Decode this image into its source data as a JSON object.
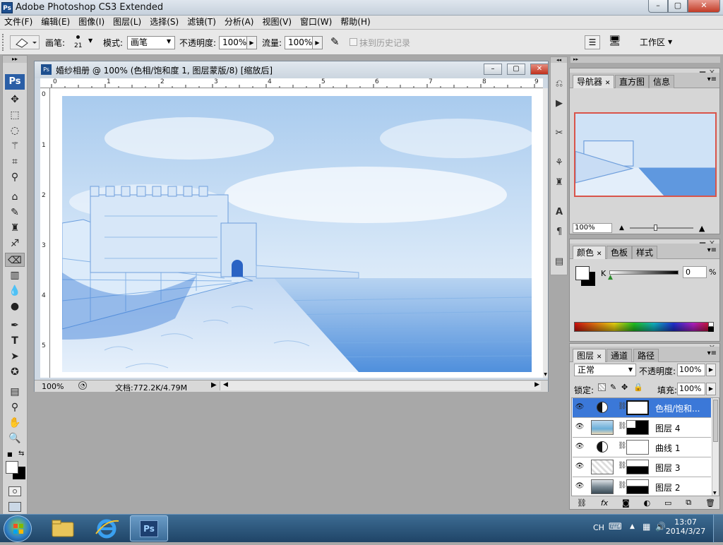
{
  "app": {
    "title": "Adobe Photoshop CS3 Extended",
    "logo": "Ps"
  },
  "window_buttons": {
    "minimize": "–",
    "maximize": "▢",
    "close": "✕"
  },
  "menu": [
    "文件(F)",
    "编辑(E)",
    "图像(I)",
    "图层(L)",
    "选择(S)",
    "滤镜(T)",
    "分析(A)",
    "视图(V)",
    "窗口(W)",
    "帮助(H)"
  ],
  "options": {
    "brush_label": "画笔:",
    "brush_size": "21",
    "mode_label": "模式:",
    "mode_value": "画笔",
    "opacity_label": "不透明度:",
    "opacity_value": "100%",
    "flow_label": "流量:",
    "flow_value": "100%",
    "history_erase_label": "抹到历史记录",
    "workspace_label": "工作区"
  },
  "document": {
    "title": "婚纱相册 @ 100% (色相/饱和度 1, 图层蒙版/8) [缩放后]",
    "zoom": "100%",
    "doc_info": "文档:772.2K/4.79M",
    "ruler_h": [
      "0",
      "1",
      "2",
      "3",
      "4",
      "5",
      "6",
      "7",
      "8",
      "9"
    ],
    "ruler_v": [
      "0",
      "1",
      "2",
      "3",
      "4",
      "5"
    ]
  },
  "navigator": {
    "tabs": [
      "导航器",
      "直方图",
      "信息"
    ],
    "zoom": "100%"
  },
  "color_panel": {
    "tabs": [
      "颜色",
      "色板",
      "样式"
    ],
    "channel": "K",
    "value": "0",
    "unit": "%"
  },
  "layers_panel": {
    "tabs": [
      "图层",
      "通道",
      "路径"
    ],
    "blend_mode": "正常",
    "opacity_label": "不透明度:",
    "opacity_value": "100%",
    "lock_label": "锁定:",
    "fill_label": "填充:",
    "fill_value": "100%",
    "layers": [
      {
        "name": "色相/饱和...",
        "selected": true,
        "type": "adjustment"
      },
      {
        "name": "图层 4",
        "selected": false,
        "type": "image"
      },
      {
        "name": "曲线 1",
        "selected": false,
        "type": "adjustment"
      },
      {
        "name": "图层 3",
        "selected": false,
        "type": "image"
      },
      {
        "name": "图层 2",
        "selected": false,
        "type": "image"
      }
    ],
    "bottom_icons": [
      "link-icon",
      "fx-icon",
      "mask-icon",
      "adjustment-icon",
      "folder-icon",
      "new-layer-icon",
      "trash-icon"
    ]
  },
  "tools": [
    "move-tool-icon",
    "marquee-tool-icon",
    "lasso-tool-icon",
    "magic-wand-tool-icon",
    "crop-tool-icon",
    "eyedropper-tool-icon",
    "healing-brush-tool-icon",
    "brush-tool-icon",
    "clone-stamp-tool-icon",
    "history-brush-tool-icon",
    "eraser-tool-icon",
    "gradient-tool-icon",
    "blur-tool-icon",
    "dodge-tool-icon",
    "pen-tool-icon",
    "type-tool-icon",
    "path-selection-tool-icon",
    "shape-tool-icon",
    "notes-tool-icon",
    "eyedropper2-tool-icon",
    "hand-tool-icon",
    "zoom-tool-icon"
  ],
  "taskbar": {
    "time": "13:07",
    "date": "2014/3/27",
    "lang": "CH"
  }
}
